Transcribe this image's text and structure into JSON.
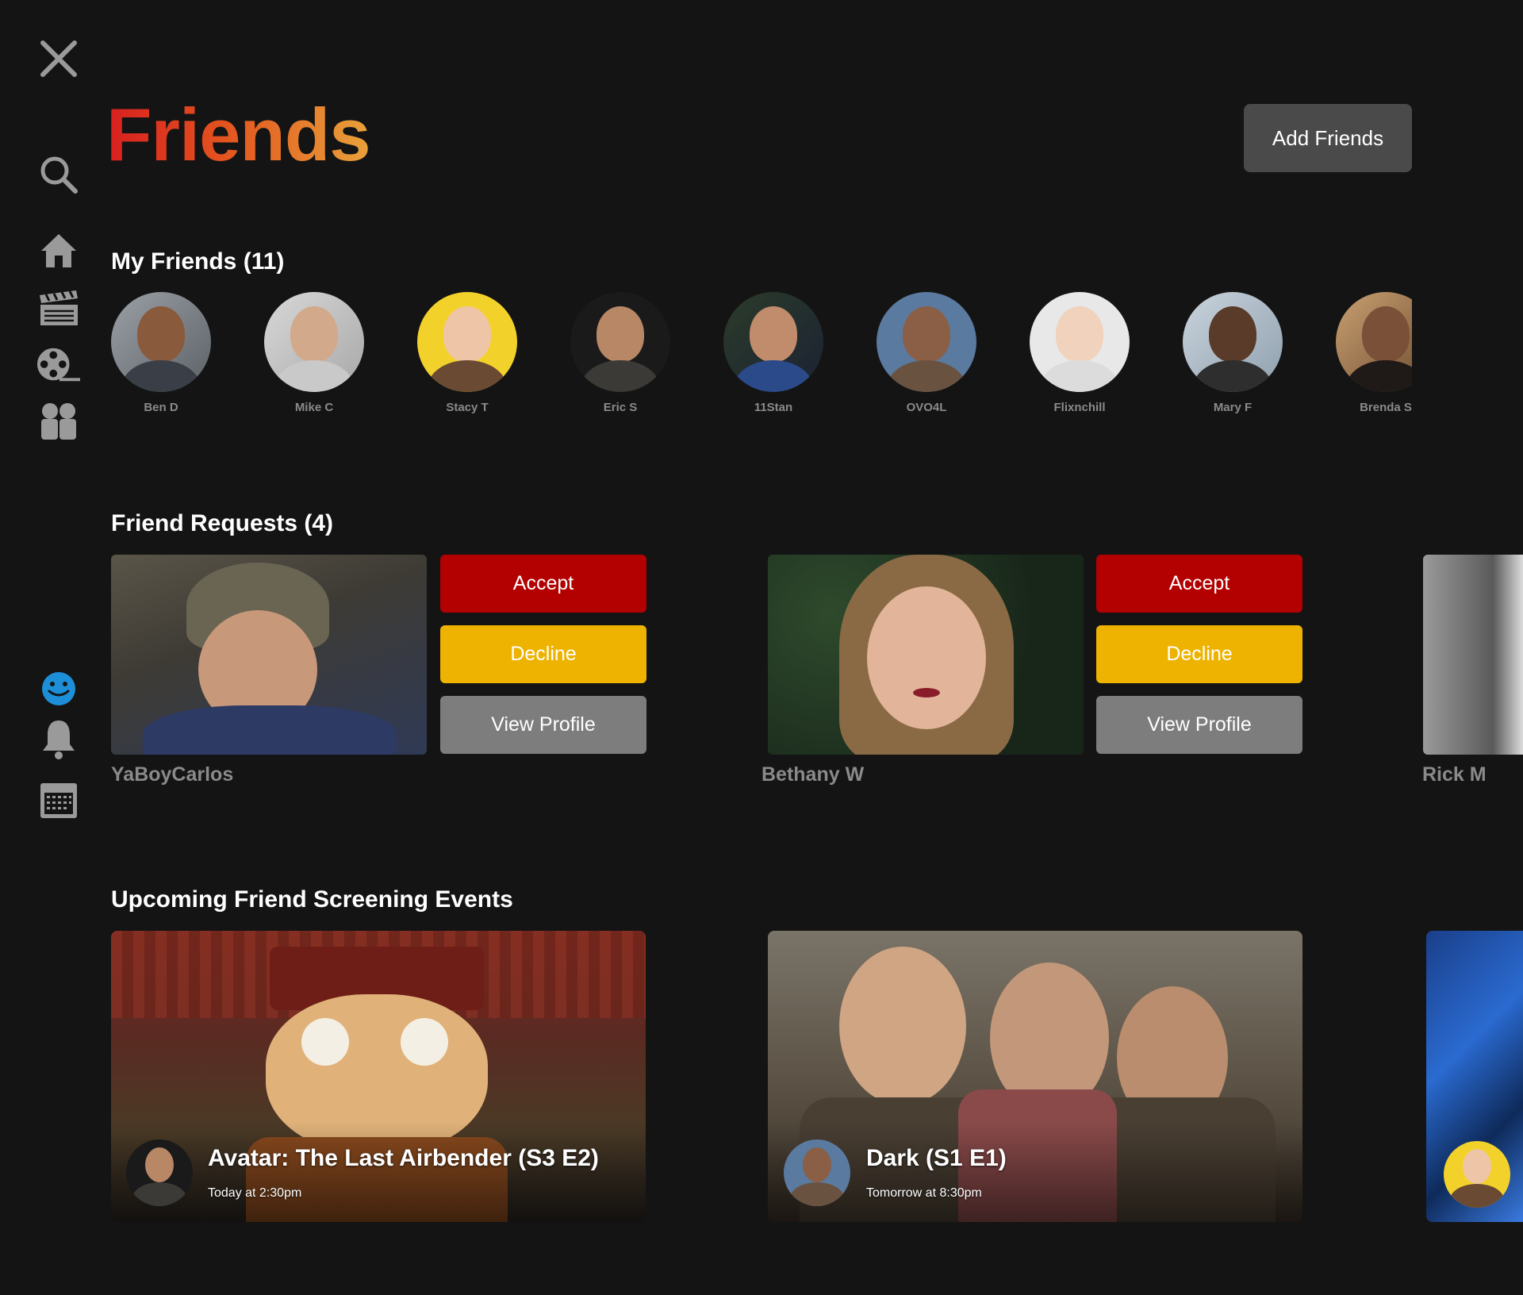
{
  "header": {
    "title": "Friends",
    "add_friends_label": "Add Friends"
  },
  "sidebar": {
    "top_icons": [
      "close-icon"
    ],
    "items": [
      "search-icon",
      "home-icon",
      "clapperboard-icon",
      "film-reel-icon",
      "groups-icon"
    ],
    "bottom_items": [
      "smile-profile-icon",
      "bell-icon",
      "calendar-icon"
    ]
  },
  "my_friends": {
    "title": "My Friends (11)",
    "items": [
      {
        "name": "Ben D"
      },
      {
        "name": "Mike C"
      },
      {
        "name": "Stacy T"
      },
      {
        "name": "Eric S"
      },
      {
        "name": "11Stan"
      },
      {
        "name": "OVO4L"
      },
      {
        "name": "Flixnchill"
      },
      {
        "name": "Mary F"
      },
      {
        "name": "Brenda S"
      }
    ]
  },
  "friend_requests": {
    "title": "Friend Requests (4)",
    "accept_label": "Accept",
    "decline_label": "Decline",
    "view_profile_label": "View Profile",
    "items": [
      {
        "name": "YaBoyCarlos"
      },
      {
        "name": "Bethany W"
      },
      {
        "name": "Rick M"
      }
    ]
  },
  "events": {
    "title": "Upcoming Friend Screening Events",
    "items": [
      {
        "title": "Avatar: The Last Airbender (S3 E2)",
        "time": "Today at 2:30pm"
      },
      {
        "title": "Dark (S1 E1)",
        "time": "Tomorrow at 8:30pm"
      }
    ]
  },
  "colors": {
    "background": "#141414",
    "accept": "#b30000",
    "decline": "#edb300",
    "view_profile": "#7d7d7d",
    "add_friends": "#4a4a4a",
    "profile_icon": "#1d8fd8"
  }
}
